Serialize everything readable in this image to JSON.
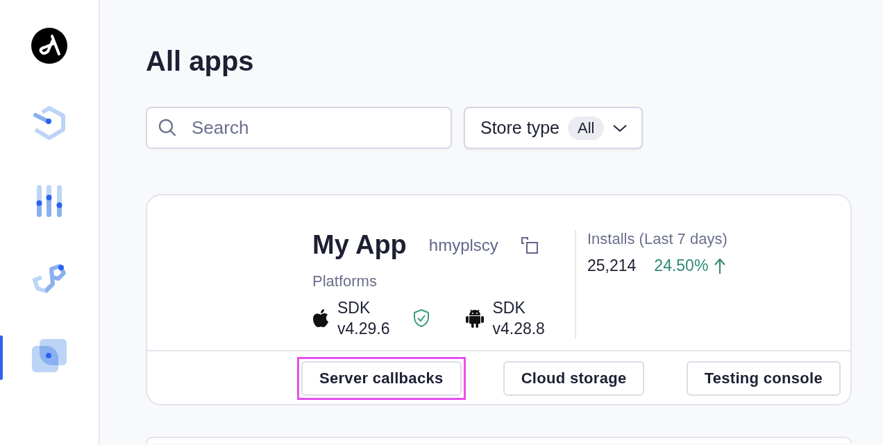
{
  "sidebar": {
    "items": [
      {
        "kind": "logo",
        "selected": false
      },
      {
        "kind": "hexagon",
        "selected": false
      },
      {
        "kind": "sliders",
        "selected": false
      },
      {
        "kind": "chain",
        "selected": false
      },
      {
        "kind": "squares",
        "selected": true
      }
    ]
  },
  "page": {
    "title": "All apps"
  },
  "filters": {
    "search": {
      "placeholder": "Search"
    },
    "store_type": {
      "label": "Store type",
      "value": "All"
    }
  },
  "apps": [
    {
      "name": "My App",
      "id": "hmyplscy",
      "platforms_label": "Platforms",
      "platforms": [
        {
          "kind": "apple",
          "sdk": "SDK",
          "version": "v4.29.6",
          "verified": true
        },
        {
          "kind": "android",
          "sdk": "SDK",
          "version": "v4.28.8",
          "verified": false
        }
      ],
      "installs_label": "Installs (Last 7 days)",
      "installs": "25,214",
      "change": "24.50%",
      "actions": [
        {
          "label": "Server callbacks",
          "highlighted": true
        },
        {
          "label": "Cloud storage",
          "highlighted": false
        },
        {
          "label": "Testing console",
          "highlighted": false
        }
      ]
    }
  ]
}
